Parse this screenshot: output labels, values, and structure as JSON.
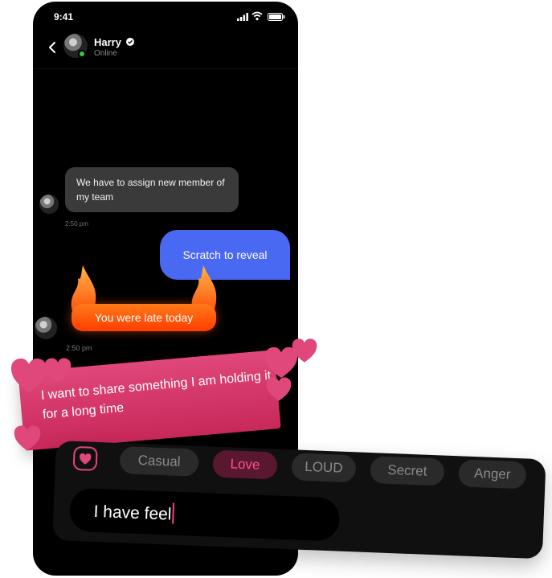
{
  "status_bar": {
    "time": "9:41"
  },
  "header": {
    "name": "Harry",
    "status": "Online"
  },
  "messages": [
    {
      "text": "We have to assign new member of my team",
      "time": "2:50 pm"
    },
    {
      "text": "Scratch to reveal"
    },
    {
      "text": "You were late today",
      "time": "2:50 pm"
    }
  ],
  "note": {
    "text": "I want to share something I am holding it for a long time"
  },
  "emotions": [
    "Casual",
    "Love",
    "LOUD",
    "Secret",
    "Anger"
  ],
  "active_emotion": "Love",
  "input": {
    "value": "I have feel"
  },
  "colors": {
    "accent": "#e0477a",
    "sent_bubble": "#4a69f2",
    "fire": "#ff5a00",
    "online": "#2ecc40"
  },
  "icons": [
    "signal-icon",
    "wifi-icon",
    "battery-icon",
    "back-arrow-icon",
    "verified-badge-icon",
    "heart-icon",
    "flame-icon"
  ]
}
